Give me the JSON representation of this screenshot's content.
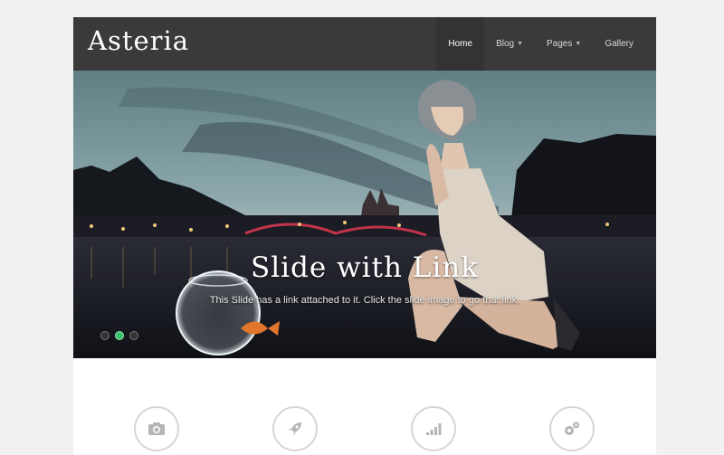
{
  "header": {
    "logo": "Asteria",
    "nav": [
      {
        "label": "Home"
      },
      {
        "label": "Blog"
      },
      {
        "label": "Pages"
      },
      {
        "label": "Gallery"
      }
    ]
  },
  "slider": {
    "title": "Slide with Link",
    "caption": "This Slide has a link attached to it. Click the slide image to go that link.",
    "active_dot": 2,
    "dot_count": 3
  },
  "features": {
    "icons": [
      "camera-icon",
      "rocket-icon",
      "signal-bars-icon",
      "gears-icon"
    ]
  },
  "colors": {
    "header_bg": "#3a3a3a",
    "accent": "#37c26b",
    "page_bg": "#f1f1f1"
  }
}
